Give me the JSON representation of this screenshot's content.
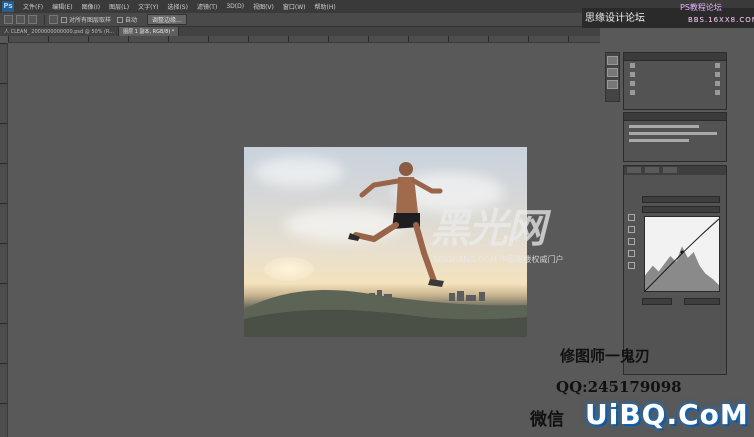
{
  "menubar": {
    "items": [
      "文件(F)",
      "编辑(E)",
      "图像(I)",
      "图层(L)",
      "文字(Y)",
      "选择(S)",
      "滤镜(T)",
      "3D(D)",
      "视图(V)",
      "窗口(W)",
      "帮助(H)"
    ]
  },
  "optbar": {
    "sample_label": "对所有图层取样",
    "auto_label": "自动",
    "refine_button": "调整边缘..."
  },
  "tabs": [
    {
      "label": "人 CLEAN_ 2000000000000.psd @ 50% (R...",
      "active": false
    },
    {
      "label": "图层 1 副本, RGB/8) *",
      "active": true
    }
  ],
  "watermark": {
    "logo": "黑光网",
    "subtitle": "BEIGUANG.COM 中国影楼权威门户"
  },
  "captions": {
    "line1": "修图师一鬼刃",
    "line2": "QQ:245179098",
    "line3": "微信"
  },
  "site": {
    "name": "思缘设计论坛",
    "ps_label": "PS教程论坛",
    "url": "BBS.16XX8.COM"
  },
  "brand": {
    "text": "UiBQ.CoM"
  }
}
